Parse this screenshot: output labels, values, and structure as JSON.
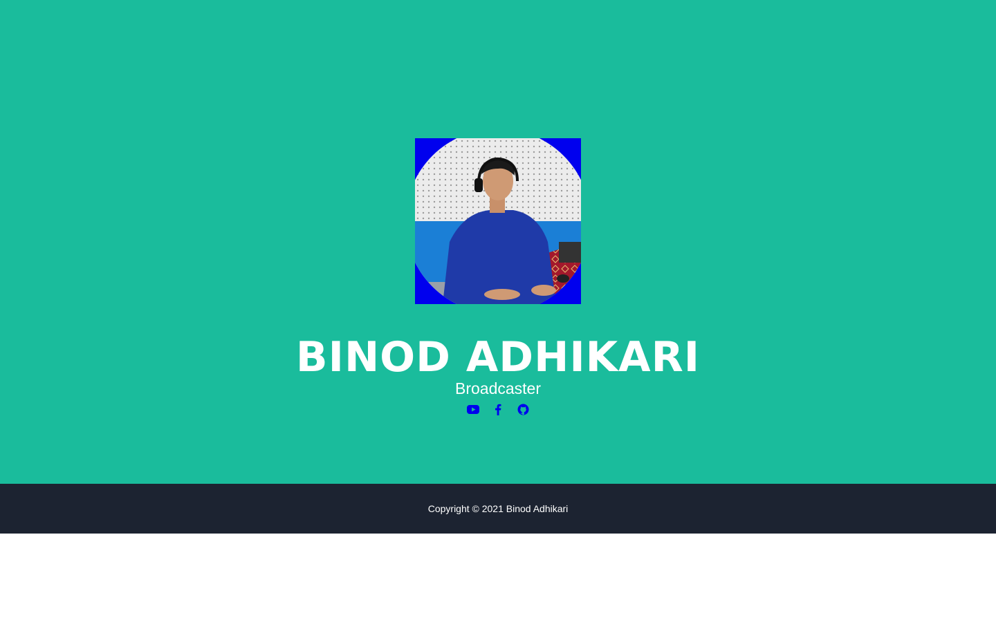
{
  "profile": {
    "name": "BINOD ADHIKARI",
    "role": "Broadcaster"
  },
  "social": [
    {
      "icon": "youtube-icon"
    },
    {
      "icon": "facebook-icon"
    },
    {
      "icon": "github-icon"
    }
  ],
  "footer": {
    "copyright": "Copyright © 2021 Binod Adhikari"
  },
  "colors": {
    "masthead": "#1abc9c",
    "photo_background": "#0000ee",
    "icon": "#0000ee",
    "footer": "#1c2331",
    "text": "#ffffff"
  }
}
